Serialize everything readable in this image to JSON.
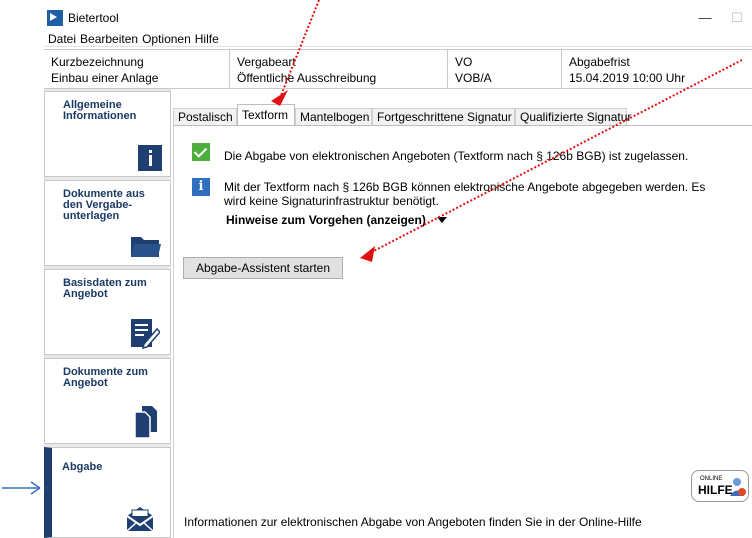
{
  "window": {
    "title": "Bietertool",
    "min": "—",
    "max": "☐",
    "close": "✕"
  },
  "menu": [
    "Datei",
    "Bearbeiten",
    "Optionen",
    "Hilfe"
  ],
  "header": {
    "cols": [
      {
        "label": "Kurzbezeichnung",
        "value": "Einbau einer Anlage"
      },
      {
        "label": "Vergabeart",
        "value": "Öffentliche Ausschreibung"
      },
      {
        "label": "VO",
        "value": "VOB/A"
      },
      {
        "label": "Abgabefrist",
        "value": "15.04.2019 10:00 Uhr"
      }
    ]
  },
  "sidebar": {
    "items": [
      {
        "label": "Allgemeine Informationen",
        "icon": "info-icon"
      },
      {
        "label": "Dokumente aus den Vergabe-unterlagen",
        "icon": "folder-icon"
      },
      {
        "label": "Basisdaten zum Angebot",
        "icon": "edit-icon"
      },
      {
        "label": "Dokumente zum Angebot",
        "icon": "documents-icon"
      },
      {
        "label": "Abgabe",
        "icon": "envelope-icon"
      }
    ]
  },
  "tabs": [
    "Postalisch",
    "Textform",
    "Mantelbogen",
    "Fortgeschrittene Signatur",
    "Qualifizierte Signatur"
  ],
  "active_tab": "Textform",
  "content": {
    "allowed_text": "Die Abgabe von elektronischen Angeboten (Textform nach § 126b BGB) ist zugelassen.",
    "info_text": "Mit der Textform nach § 126b BGB können elektronische Angebote abgegeben werden. Es wird keine Signaturinfrastruktur benötigt.",
    "hinweise": "Hinweise zum Vorgehen (anzeigen)",
    "start_button": "Abgabe-Assistent starten",
    "footer_text": "Informationen zur elektronischen Abgabe von Angeboten finden Sie in der Online-Hilfe",
    "online_help": {
      "line1": "ONLINE",
      "line2": "HILFE"
    }
  },
  "colors": {
    "accent": "#1e3f70",
    "annotation_red": "#e01010",
    "annotation_blue": "#3a6fc0"
  }
}
